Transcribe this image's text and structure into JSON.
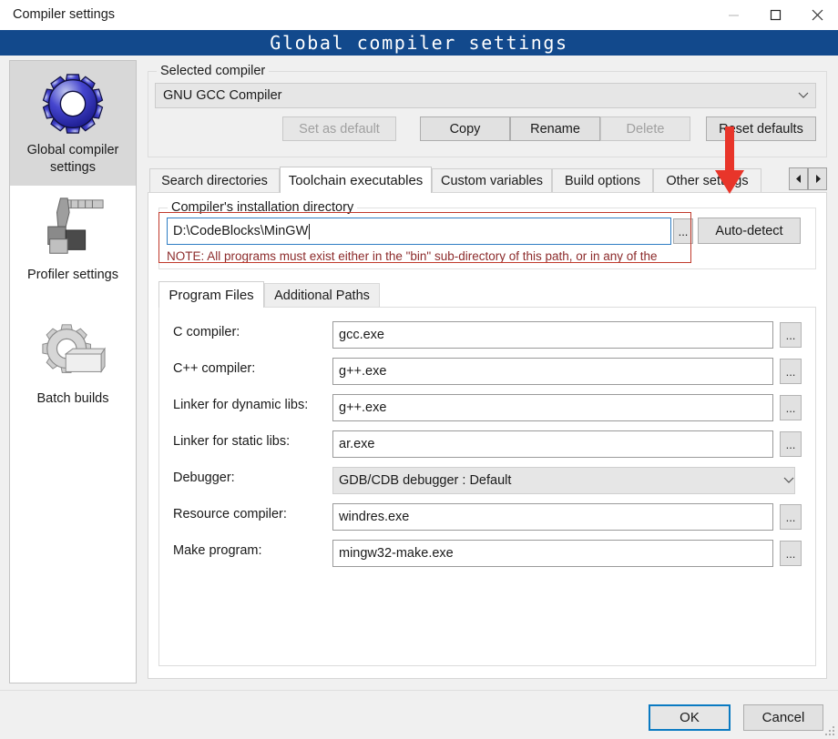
{
  "window": {
    "title": "Compiler settings",
    "controls": [
      {
        "name": "minimize-button",
        "glyph": "minimize-icon"
      },
      {
        "name": "maximize-button",
        "glyph": "maximize-icon"
      },
      {
        "name": "close-button",
        "glyph": "close-icon"
      }
    ]
  },
  "banner": {
    "title": "Global compiler settings",
    "bg_color": "#12498c",
    "text_color": "#ffffff"
  },
  "sidebar": {
    "items": [
      {
        "label": "Global compiler settings",
        "icon": "blue-gear-icon",
        "selected": true
      },
      {
        "label": "Profiler settings",
        "icon": "caliper-blocks-icon",
        "selected": false
      },
      {
        "label": "Batch builds",
        "icon": "gear-stack-icon",
        "selected": false
      }
    ]
  },
  "selected_compiler": {
    "group_title": "Selected compiler",
    "combo_value": "GNU GCC Compiler",
    "buttons": [
      {
        "label": "Set as default",
        "enabled": false
      },
      {
        "label": "Copy",
        "enabled": true
      },
      {
        "label": "Rename",
        "enabled": true
      },
      {
        "label": "Delete",
        "enabled": false
      },
      {
        "label": "Reset defaults",
        "enabled": true
      }
    ]
  },
  "tabs": {
    "items": [
      {
        "label": "Search directories",
        "active": false
      },
      {
        "label": "Toolchain executables",
        "active": true
      },
      {
        "label": "Custom variables",
        "active": false
      },
      {
        "label": "Build options",
        "active": false
      },
      {
        "label": "Other settings",
        "active": false
      }
    ],
    "nav_prev": "◄",
    "nav_next": "►"
  },
  "install_dir": {
    "group_title": "Compiler's installation directory",
    "path_value": "D:\\CodeBlocks\\MinGW",
    "browse_label": "...",
    "autodetect_label": "Auto-detect",
    "note": "NOTE: All programs must exist either in the \"bin\" sub-directory of this path, or in any of the",
    "note_color": "#8c2b2b",
    "highlight_color": "#c0392b"
  },
  "inner_tabs": {
    "items": [
      {
        "label": "Program Files",
        "active": true
      },
      {
        "label": "Additional Paths",
        "active": false
      }
    ]
  },
  "program_files": {
    "fields": [
      {
        "label": "C compiler:",
        "value": "gcc.exe",
        "type": "text",
        "browse": "..."
      },
      {
        "label": "C++ compiler:",
        "value": "g++.exe",
        "type": "text",
        "browse": "..."
      },
      {
        "label": "Linker for dynamic libs:",
        "value": "g++.exe",
        "type": "text",
        "browse": "..."
      },
      {
        "label": "Linker for static libs:",
        "value": "ar.exe",
        "type": "text",
        "browse": "..."
      },
      {
        "label": "Debugger:",
        "value": "GDB/CDB debugger : Default",
        "type": "combo",
        "browse": ""
      },
      {
        "label": "Resource compiler:",
        "value": "windres.exe",
        "type": "text",
        "browse": "..."
      },
      {
        "label": "Make program:",
        "value": "mingw32-make.exe",
        "type": "text",
        "browse": "..."
      }
    ]
  },
  "footer": {
    "ok_label": "OK",
    "cancel_label": "Cancel",
    "focus_color": "#0a7ac2"
  }
}
